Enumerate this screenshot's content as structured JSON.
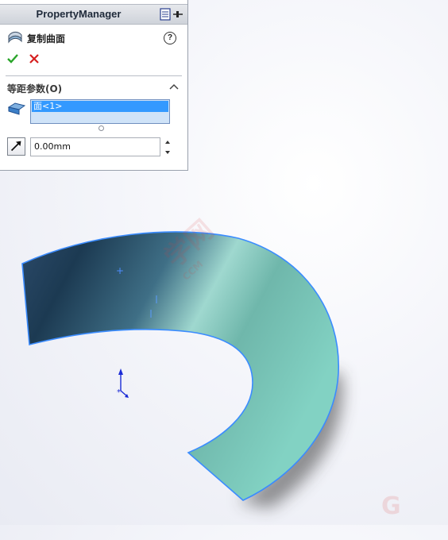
{
  "property_manager": {
    "title": "PropertyManager",
    "feature_title": "复制曲面",
    "help_label": "?",
    "section_title": "等距参数(O)",
    "selection_items": [
      "面<1>"
    ],
    "distance_value": "0.00mm"
  },
  "icons": {
    "feature": "offset-surface-icon",
    "ok": "checkmark-icon",
    "cancel": "close-icon",
    "help": "help-icon",
    "collapse": "chevron-up-icon",
    "face_selection": "face-selection-icon",
    "distance": "reverse-direction-icon",
    "pin": "pin-icon",
    "triad": "coordinate-triad-icon"
  },
  "watermark": {
    "text": "学网",
    "small_text": "CCM",
    "corner_text": "G"
  },
  "colors": {
    "ok_green": "#2aa52a",
    "cancel_red": "#d61f1f",
    "selection_blue": "#3399ff",
    "surface_teal": "#7fcfbf",
    "surface_dark": "#1c3a52",
    "edge_blue": "#3b8cff"
  }
}
